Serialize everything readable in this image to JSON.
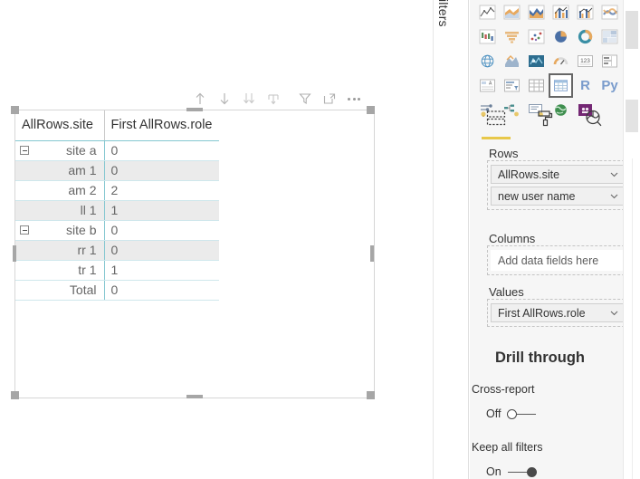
{
  "visual_toolbar": {
    "buttons": [
      {
        "name": "drill-up-icon",
        "title": "Drill up"
      },
      {
        "name": "drill-down-icon",
        "title": "Drill down"
      },
      {
        "name": "expand-all-icon",
        "title": "Expand all down one level in the hierarchy"
      },
      {
        "name": "drill-mode-icon",
        "title": "Go to the next level in the hierarchy"
      },
      {
        "name": "filter-icon",
        "title": "Filters"
      },
      {
        "name": "focus-mode-icon",
        "title": "Focus mode"
      },
      {
        "name": "more-options-icon",
        "title": "More options"
      }
    ]
  },
  "matrix": {
    "columns": [
      "AllRows.site",
      "First AllRows.role"
    ],
    "rows": [
      {
        "label": "site a",
        "value": "0",
        "level": "group",
        "expander": true,
        "banded": false
      },
      {
        "label": "am 1",
        "value": "0",
        "level": "detail",
        "expander": false,
        "banded": true
      },
      {
        "label": "am 2",
        "value": "2",
        "level": "detail",
        "expander": false,
        "banded": false
      },
      {
        "label": "ll 1",
        "value": "1",
        "level": "detail",
        "expander": false,
        "banded": true
      },
      {
        "label": "site b",
        "value": "0",
        "level": "group",
        "expander": true,
        "banded": false
      },
      {
        "label": "rr 1",
        "value": "0",
        "level": "detail",
        "expander": false,
        "banded": true
      },
      {
        "label": "tr 1",
        "value": "1",
        "level": "detail",
        "expander": false,
        "banded": false
      },
      {
        "label": "Total",
        "value": "0",
        "level": "total",
        "expander": false,
        "banded": false
      }
    ]
  },
  "filters_pane": {
    "label": "Filters"
  },
  "visualizations": {
    "icons": [
      {
        "name": "stacked-area-line-chart-icon",
        "selected": false
      },
      {
        "name": "area-chart-icon",
        "selected": false
      },
      {
        "name": "stacked-area-chart-icon",
        "selected": false
      },
      {
        "name": "line-stacked-column-chart-icon",
        "selected": false
      },
      {
        "name": "line-clustered-column-chart-icon",
        "selected": false
      },
      {
        "name": "ribbon-chart-icon",
        "selected": false
      },
      {
        "name": "waterfall-chart-icon",
        "selected": false
      },
      {
        "name": "funnel-chart-icon",
        "selected": false
      },
      {
        "name": "scatter-chart-icon",
        "selected": false
      },
      {
        "name": "pie-chart-icon",
        "selected": false
      },
      {
        "name": "donut-chart-icon",
        "selected": false
      },
      {
        "name": "treemap-icon",
        "selected": false
      },
      {
        "name": "map-icon",
        "selected": false
      },
      {
        "name": "filled-map-icon",
        "selected": false
      },
      {
        "name": "shape-map-icon",
        "selected": false
      },
      {
        "name": "gauge-icon",
        "selected": false
      },
      {
        "name": "card-icon",
        "selected": false
      },
      {
        "name": "multi-row-card-icon",
        "selected": false
      },
      {
        "name": "kpi-icon",
        "selected": false
      },
      {
        "name": "slicer-icon",
        "selected": false
      },
      {
        "name": "table-icon",
        "selected": false
      },
      {
        "name": "matrix-icon",
        "selected": true
      },
      {
        "name": "r-script-visual-icon",
        "selected": false,
        "letter": "R"
      },
      {
        "name": "python-visual-icon",
        "selected": false,
        "letter": "Py"
      },
      {
        "name": "key-influencers-icon",
        "selected": false
      },
      {
        "name": "decomposition-tree-icon",
        "selected": false
      },
      {
        "name": "smart-narrative-icon",
        "selected": false
      },
      {
        "name": "arcgis-maps-icon",
        "selected": false
      },
      {
        "name": "power-apps-icon",
        "selected": false
      },
      {
        "name": "get-more-visuals-icon",
        "selected": false,
        "dots": true
      }
    ],
    "tabs": [
      {
        "name": "tab-fields",
        "icon": "fields-icon",
        "selected": true
      },
      {
        "name": "tab-format",
        "icon": "paint-roller-icon",
        "selected": false
      },
      {
        "name": "tab-analytics",
        "icon": "magnifier-chart-icon",
        "selected": false
      }
    ],
    "wells": [
      {
        "name": "rows-well",
        "title": "Rows",
        "chips": [
          {
            "label": "AllRows.site"
          },
          {
            "label": "new user name"
          }
        ],
        "empty_text": null
      },
      {
        "name": "columns-well",
        "title": "Columns",
        "chips": [],
        "empty_text": "Add data fields here"
      },
      {
        "name": "values-well",
        "title": "Values",
        "chips": [
          {
            "label": "First AllRows.role"
          }
        ],
        "empty_text": null
      }
    ],
    "drill_through": {
      "heading": "Drill through",
      "cross_report": {
        "title": "Cross-report",
        "state_label": "Off",
        "on": false
      },
      "keep_all_filters": {
        "title": "Keep all filters",
        "state_label": "On",
        "on": true
      }
    }
  },
  "colors": {
    "accent_yellow": "#e8c84a",
    "matrix_grid": "#84c7d0",
    "band_gray": "#ebebeb",
    "pane_bg": "#f6f6f6",
    "text": "#333333"
  }
}
